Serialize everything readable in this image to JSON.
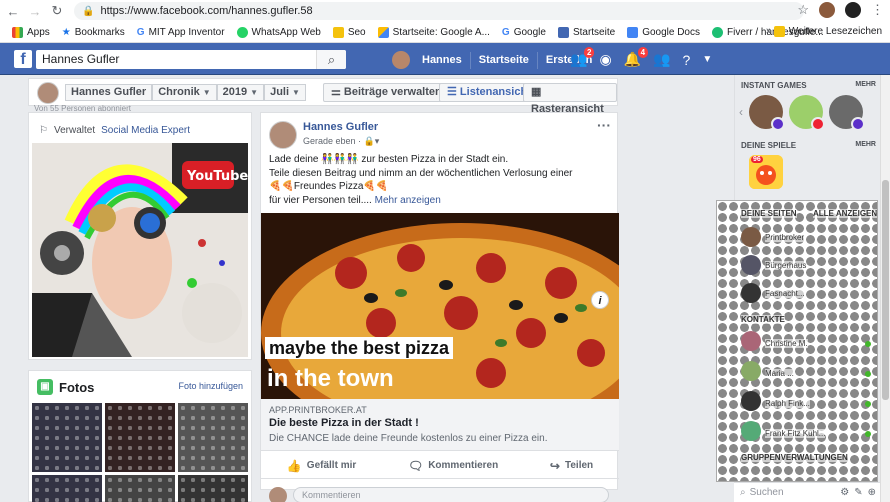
{
  "browser": {
    "url": "https://www.facebook.com/hannes.gufler.58",
    "bookmarks": [
      "Apps",
      "Bookmarks",
      "MIT App Inventor",
      "WhatsApp Web",
      "Seo",
      "Startseite: Google A...",
      "Google",
      "Startseite",
      "Google Docs",
      "Fiverr / hannesgufle..."
    ],
    "more": "»",
    "other_bookmarks": "Weitere Lesezeichen"
  },
  "fb_header": {
    "search_value": "Hannes Gufler",
    "nav": [
      "Hannes",
      "Startseite",
      "Erstellen"
    ],
    "friend_badge": "2",
    "notif_badge": "4"
  },
  "timeline_bar": {
    "crumbs": [
      "Hannes Gufler",
      "Chronik",
      "2019",
      "Juli"
    ],
    "manage_posts": "Beiträge verwalten",
    "list_view": "Listenansicht",
    "grid_view": "Rasteransicht"
  },
  "left": {
    "cut_text": "Von 55 Personen abonniert",
    "managed_prefix": "Verwaltet",
    "managed_link": "Social Media Expert",
    "photos_title": "Fotos",
    "photos_add": "Foto hinzufügen"
  },
  "post": {
    "author": "Hannes Gufler",
    "time": "Gerade eben",
    "line1": "Lade deine 👫👫👫 zur besten Pizza in der Stadt ein.",
    "line2": "Teile diesen Beitrag und nimm an der wöchentlichen Verlosung einer",
    "line3": "🍕🍕Freundes Pizza🍕🍕",
    "line4": "für vier Personen teil....",
    "more": "Mehr anzeigen",
    "image_caption1": "maybe the best pizza",
    "image_caption2": "in the town",
    "link_domain": "APP.PRINTBROKER.AT",
    "link_title": "Die beste Pizza in der Stadt !",
    "link_desc": "Die CHANCE lade deine Freunde kostenlos zu einer Pizza ein.",
    "like": "Gefällt mir",
    "comment": "Kommentieren",
    "share": "Teilen",
    "comment_placeholder": "Kommentieren"
  },
  "right": {
    "instant_games": "INSTANT GAMES",
    "more1": "MEHR",
    "your_games": "DEINE SPIELE",
    "more2": "MEHR",
    "game_badge": "96",
    "your_pages": "DEINE SEITEN",
    "show_all": "ALLE ANZEIGEN",
    "pages": [
      "Printbroker",
      "Bürgerhaus",
      "Fasnacht..."
    ],
    "contacts": "KONTAKTE",
    "contact_names": [
      "Christine M.",
      "Maria ...",
      "Ralph Fink...",
      "Frank Fitz Kuhl..."
    ],
    "group_admin": "GRUPPENVERWALTUNGEN",
    "search_placeholder": "Suchen"
  }
}
